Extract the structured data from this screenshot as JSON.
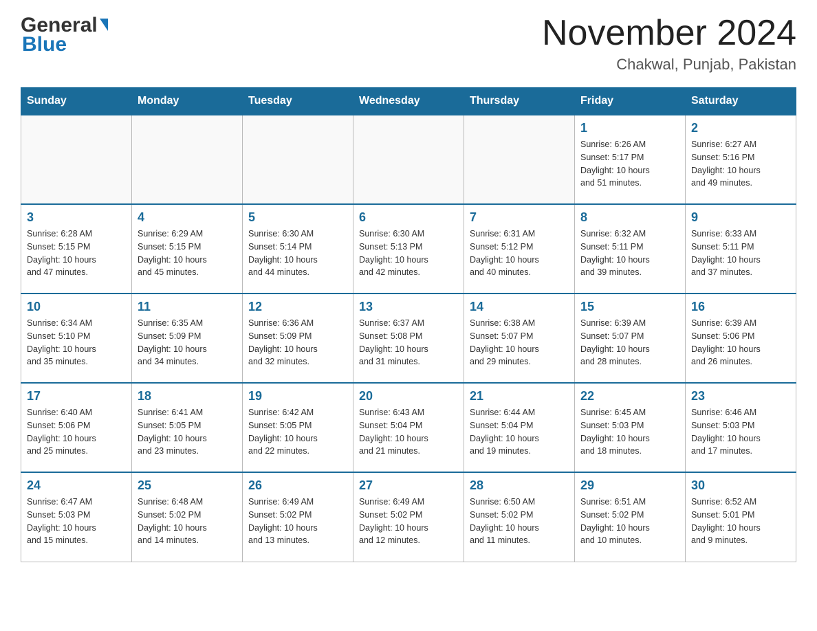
{
  "header": {
    "logo_general": "General",
    "logo_blue": "Blue",
    "month_year": "November 2024",
    "location": "Chakwal, Punjab, Pakistan"
  },
  "days_of_week": [
    "Sunday",
    "Monday",
    "Tuesday",
    "Wednesday",
    "Thursday",
    "Friday",
    "Saturday"
  ],
  "weeks": [
    {
      "days": [
        {
          "num": "",
          "info": ""
        },
        {
          "num": "",
          "info": ""
        },
        {
          "num": "",
          "info": ""
        },
        {
          "num": "",
          "info": ""
        },
        {
          "num": "",
          "info": ""
        },
        {
          "num": "1",
          "info": "Sunrise: 6:26 AM\nSunset: 5:17 PM\nDaylight: 10 hours\nand 51 minutes."
        },
        {
          "num": "2",
          "info": "Sunrise: 6:27 AM\nSunset: 5:16 PM\nDaylight: 10 hours\nand 49 minutes."
        }
      ]
    },
    {
      "days": [
        {
          "num": "3",
          "info": "Sunrise: 6:28 AM\nSunset: 5:15 PM\nDaylight: 10 hours\nand 47 minutes."
        },
        {
          "num": "4",
          "info": "Sunrise: 6:29 AM\nSunset: 5:15 PM\nDaylight: 10 hours\nand 45 minutes."
        },
        {
          "num": "5",
          "info": "Sunrise: 6:30 AM\nSunset: 5:14 PM\nDaylight: 10 hours\nand 44 minutes."
        },
        {
          "num": "6",
          "info": "Sunrise: 6:30 AM\nSunset: 5:13 PM\nDaylight: 10 hours\nand 42 minutes."
        },
        {
          "num": "7",
          "info": "Sunrise: 6:31 AM\nSunset: 5:12 PM\nDaylight: 10 hours\nand 40 minutes."
        },
        {
          "num": "8",
          "info": "Sunrise: 6:32 AM\nSunset: 5:11 PM\nDaylight: 10 hours\nand 39 minutes."
        },
        {
          "num": "9",
          "info": "Sunrise: 6:33 AM\nSunset: 5:11 PM\nDaylight: 10 hours\nand 37 minutes."
        }
      ]
    },
    {
      "days": [
        {
          "num": "10",
          "info": "Sunrise: 6:34 AM\nSunset: 5:10 PM\nDaylight: 10 hours\nand 35 minutes."
        },
        {
          "num": "11",
          "info": "Sunrise: 6:35 AM\nSunset: 5:09 PM\nDaylight: 10 hours\nand 34 minutes."
        },
        {
          "num": "12",
          "info": "Sunrise: 6:36 AM\nSunset: 5:09 PM\nDaylight: 10 hours\nand 32 minutes."
        },
        {
          "num": "13",
          "info": "Sunrise: 6:37 AM\nSunset: 5:08 PM\nDaylight: 10 hours\nand 31 minutes."
        },
        {
          "num": "14",
          "info": "Sunrise: 6:38 AM\nSunset: 5:07 PM\nDaylight: 10 hours\nand 29 minutes."
        },
        {
          "num": "15",
          "info": "Sunrise: 6:39 AM\nSunset: 5:07 PM\nDaylight: 10 hours\nand 28 minutes."
        },
        {
          "num": "16",
          "info": "Sunrise: 6:39 AM\nSunset: 5:06 PM\nDaylight: 10 hours\nand 26 minutes."
        }
      ]
    },
    {
      "days": [
        {
          "num": "17",
          "info": "Sunrise: 6:40 AM\nSunset: 5:06 PM\nDaylight: 10 hours\nand 25 minutes."
        },
        {
          "num": "18",
          "info": "Sunrise: 6:41 AM\nSunset: 5:05 PM\nDaylight: 10 hours\nand 23 minutes."
        },
        {
          "num": "19",
          "info": "Sunrise: 6:42 AM\nSunset: 5:05 PM\nDaylight: 10 hours\nand 22 minutes."
        },
        {
          "num": "20",
          "info": "Sunrise: 6:43 AM\nSunset: 5:04 PM\nDaylight: 10 hours\nand 21 minutes."
        },
        {
          "num": "21",
          "info": "Sunrise: 6:44 AM\nSunset: 5:04 PM\nDaylight: 10 hours\nand 19 minutes."
        },
        {
          "num": "22",
          "info": "Sunrise: 6:45 AM\nSunset: 5:03 PM\nDaylight: 10 hours\nand 18 minutes."
        },
        {
          "num": "23",
          "info": "Sunrise: 6:46 AM\nSunset: 5:03 PM\nDaylight: 10 hours\nand 17 minutes."
        }
      ]
    },
    {
      "days": [
        {
          "num": "24",
          "info": "Sunrise: 6:47 AM\nSunset: 5:03 PM\nDaylight: 10 hours\nand 15 minutes."
        },
        {
          "num": "25",
          "info": "Sunrise: 6:48 AM\nSunset: 5:02 PM\nDaylight: 10 hours\nand 14 minutes."
        },
        {
          "num": "26",
          "info": "Sunrise: 6:49 AM\nSunset: 5:02 PM\nDaylight: 10 hours\nand 13 minutes."
        },
        {
          "num": "27",
          "info": "Sunrise: 6:49 AM\nSunset: 5:02 PM\nDaylight: 10 hours\nand 12 minutes."
        },
        {
          "num": "28",
          "info": "Sunrise: 6:50 AM\nSunset: 5:02 PM\nDaylight: 10 hours\nand 11 minutes."
        },
        {
          "num": "29",
          "info": "Sunrise: 6:51 AM\nSunset: 5:02 PM\nDaylight: 10 hours\nand 10 minutes."
        },
        {
          "num": "30",
          "info": "Sunrise: 6:52 AM\nSunset: 5:01 PM\nDaylight: 10 hours\nand 9 minutes."
        }
      ]
    }
  ]
}
